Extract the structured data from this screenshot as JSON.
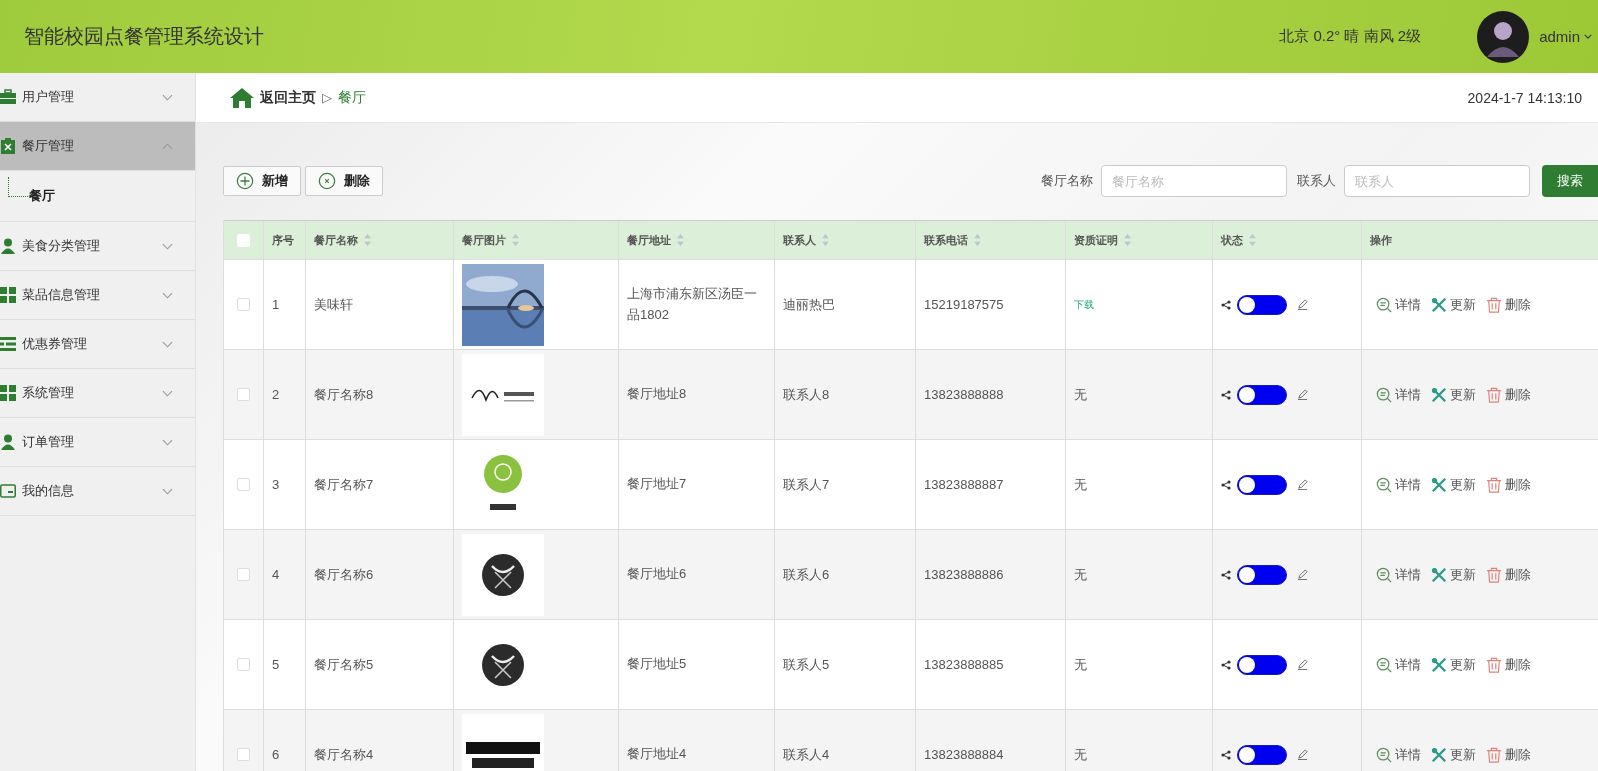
{
  "header": {
    "title": "智能校园点餐管理系统设计",
    "weather": "北京 0.2° 晴 南风 2级",
    "user": "admin"
  },
  "sidebar": {
    "items": [
      {
        "label": "用户管理",
        "expanded": false,
        "selected": false
      },
      {
        "label": "餐厅管理",
        "expanded": true,
        "selected": true,
        "children": [
          {
            "label": "餐厅",
            "selected": true
          }
        ]
      },
      {
        "label": "美食分类管理",
        "expanded": false,
        "selected": false
      },
      {
        "label": "菜品信息管理",
        "expanded": false,
        "selected": false
      },
      {
        "label": "优惠券管理",
        "expanded": false,
        "selected": false
      },
      {
        "label": "系统管理",
        "expanded": false,
        "selected": false
      },
      {
        "label": "订单管理",
        "expanded": false,
        "selected": false
      },
      {
        "label": "我的信息",
        "expanded": false,
        "selected": false
      }
    ]
  },
  "breadcrumb": {
    "home": "返回主页",
    "separator": "▷",
    "current": "餐厅"
  },
  "datetime": "2024-1-7 14:13:10",
  "toolbar": {
    "buttons": [
      {
        "label": "新增",
        "kind": "add"
      },
      {
        "label": "删除",
        "kind": "delete"
      }
    ]
  },
  "search": {
    "fields": [
      {
        "label": "餐厅名称",
        "placeholder": "餐厅名称"
      },
      {
        "label": "联系人",
        "placeholder": "联系人"
      }
    ],
    "button": "搜索"
  },
  "table": {
    "select_all_checked": false,
    "columns": [
      {
        "label": "序号",
        "sortable": false
      },
      {
        "label": "餐厅名称",
        "sortable": true
      },
      {
        "label": "餐厅图片",
        "sortable": true
      },
      {
        "label": "餐厅地址",
        "sortable": true
      },
      {
        "label": "联系人",
        "sortable": true
      },
      {
        "label": "联系电话",
        "sortable": true
      },
      {
        "label": "资质证明",
        "sortable": true
      },
      {
        "label": "状态",
        "sortable": true
      },
      {
        "label": "操作",
        "sortable": false
      }
    ],
    "rows": [
      {
        "checked": false,
        "index": "1",
        "name": "美味轩",
        "address": "上海市浦东新区汤臣一品1802",
        "contact": "迪丽热巴",
        "phone": "15219187575",
        "cert": {
          "text": "下载",
          "kind": "link"
        },
        "status_on": false,
        "actions": [
          "详情",
          "更新",
          "删除"
        ]
      },
      {
        "checked": false,
        "index": "2",
        "name": "餐厅名称8",
        "address": "餐厅地址8",
        "contact": "联系人8",
        "phone": "13823888888",
        "cert": {
          "text": "无",
          "kind": "text"
        },
        "status_on": false,
        "actions": [
          "详情",
          "更新",
          "删除"
        ]
      },
      {
        "checked": false,
        "index": "3",
        "name": "餐厅名称7",
        "address": "餐厅地址7",
        "contact": "联系人7",
        "phone": "13823888887",
        "cert": {
          "text": "无",
          "kind": "text"
        },
        "status_on": false,
        "actions": [
          "详情",
          "更新",
          "删除"
        ]
      },
      {
        "checked": false,
        "index": "4",
        "name": "餐厅名称6",
        "address": "餐厅地址6",
        "contact": "联系人6",
        "phone": "13823888886",
        "cert": {
          "text": "无",
          "kind": "text"
        },
        "status_on": false,
        "actions": [
          "详情",
          "更新",
          "删除"
        ]
      },
      {
        "checked": false,
        "index": "5",
        "name": "餐厅名称5",
        "address": "餐厅地址5",
        "contact": "联系人5",
        "phone": "13823888885",
        "cert": {
          "text": "无",
          "kind": "text"
        },
        "status_on": false,
        "actions": [
          "详情",
          "更新",
          "删除"
        ]
      },
      {
        "checked": false,
        "index": "6",
        "name": "餐厅名称4",
        "address": "餐厅地址4",
        "contact": "联系人4",
        "phone": "13823888884",
        "cert": {
          "text": "无",
          "kind": "text"
        },
        "status_on": false,
        "actions": [
          "详情",
          "更新",
          "删除"
        ]
      }
    ]
  }
}
